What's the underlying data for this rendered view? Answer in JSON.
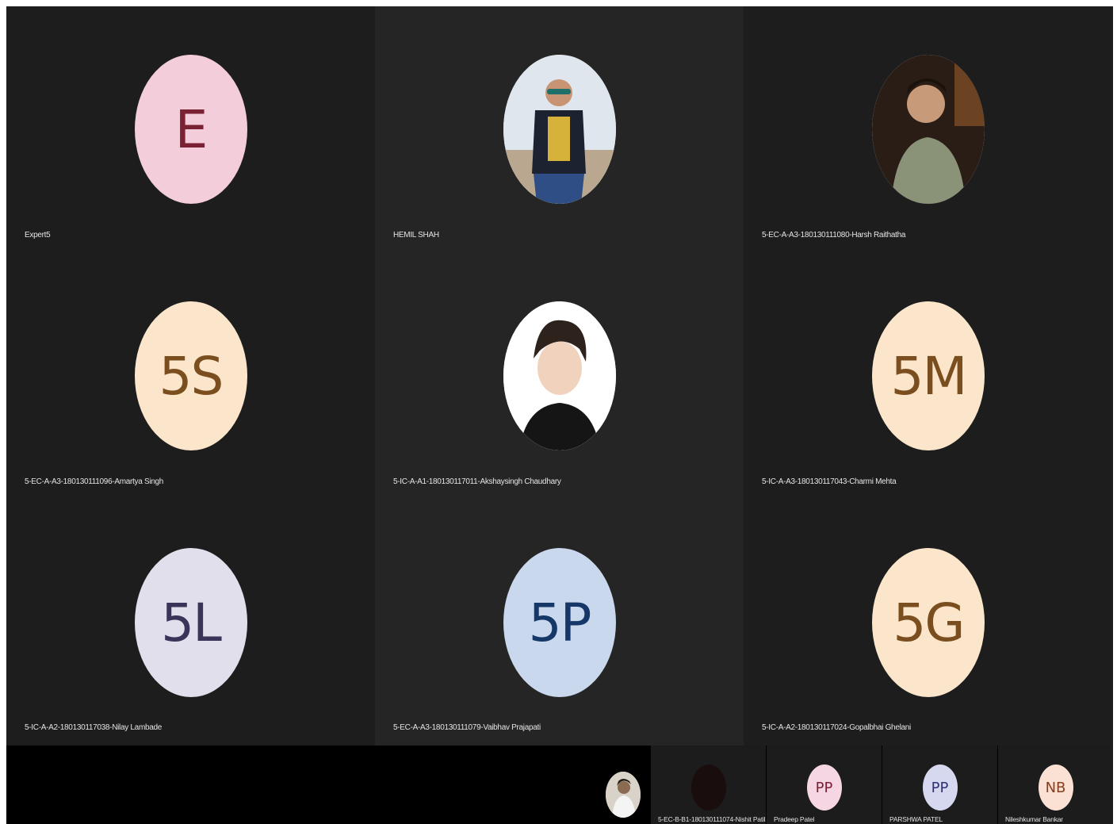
{
  "participants": [
    {
      "name": "Expert5",
      "initials": "E",
      "type": "initials",
      "bg": "#f3cdd9",
      "fg": "#7a2134"
    },
    {
      "name": "HEMIL SHAH",
      "initials": "",
      "type": "photo",
      "bg": "#e6eaf0",
      "fg": "#000000"
    },
    {
      "name": "5-EC-A-A3-180130111080-Harsh Raithatha",
      "initials": "",
      "type": "photo",
      "bg": "#ffffff",
      "fg": "#000000"
    },
    {
      "name": "5-EC-A-A3-180130111096-Amartya Singh",
      "initials": "5S",
      "type": "initials",
      "bg": "#fbe6cc",
      "fg": "#7a4e1e"
    },
    {
      "name": "5-IC-A-A1-180130117011-Akshaysingh Chaudhary",
      "initials": "",
      "type": "photo",
      "bg": "#ffffff",
      "fg": "#000000"
    },
    {
      "name": "5-IC-A-A3-180130117043-Charmi Mehta",
      "initials": "5M",
      "type": "initials",
      "bg": "#fbe6cc",
      "fg": "#7a4e1e"
    },
    {
      "name": "5-IC-A-A2-180130117038-Nilay Lambade",
      "initials": "5L",
      "type": "initials",
      "bg": "#e2dfed",
      "fg": "#3a3458"
    },
    {
      "name": "5-EC-A-A3-180130111079-Vaibhav Prajapati",
      "initials": "5P",
      "type": "initials",
      "bg": "#c9d8ec",
      "fg": "#163868"
    },
    {
      "name": "5-IC-A-A2-180130117024-Gopalbhai Ghelani",
      "initials": "5G",
      "type": "initials",
      "bg": "#fbe6cc",
      "fg": "#7a4e1e"
    }
  ],
  "strip": [
    {
      "name": "5-EC-B-B1-180130111074-Nishit Patil",
      "initials": "",
      "bg": "#1a0d0d",
      "fg": "#000000"
    },
    {
      "name": "Pradeep Patel",
      "initials": "PP",
      "bg": "#f6d6e2",
      "fg": "#7a2134"
    },
    {
      "name": "PARSHWA PATEL",
      "initials": "PP",
      "bg": "#d6d8ef",
      "fg": "#2d3374"
    },
    {
      "name": "Nileshkumar  Bankar",
      "initials": "NB",
      "bg": "#fbe1d3",
      "fg": "#8a3d1c"
    }
  ]
}
